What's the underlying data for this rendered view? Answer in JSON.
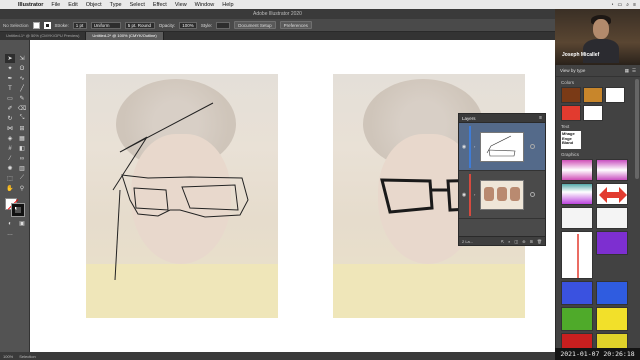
{
  "menubar": {
    "app_name": "Illustrator",
    "items": [
      "File",
      "Edit",
      "Object",
      "Type",
      "Select",
      "Effect",
      "View",
      "Window",
      "Help"
    ]
  },
  "window": {
    "title": "Adobe Illustrator 2020"
  },
  "controlbar": {
    "selection_label": "No Selection",
    "stroke_label": "Stroke:",
    "stroke_weight": "1 pt",
    "profile": "Uniform",
    "brush": "5 pt. Round",
    "opacity_label": "Opacity:",
    "opacity_value": "100%",
    "style_label": "Style:",
    "document_setup": "Document Setup",
    "preferences": "Preferences"
  },
  "tabs": [
    {
      "label": "Untitled-1* @ 50% (CMYK/GPU Preview)",
      "active": false
    },
    {
      "label": "Untitled-2* @ 100% (CMYK/Outline)",
      "active": true
    }
  ],
  "layers": {
    "title": "Layers",
    "footer_count": "2 La...",
    "rows": [
      {
        "name": "Layer 2",
        "selected": true
      },
      {
        "name": "Layer 1",
        "selected": false
      }
    ]
  },
  "libraries": {
    "user_name": "Joseph Micallef",
    "view_by": "View by type",
    "sections": {
      "colors": "Colors",
      "text": "Text",
      "graphics": "Graphics"
    },
    "colors": [
      "#7a3a16",
      "#c8862b",
      "#ffffff",
      "#e23b2f",
      "#ffffff"
    ],
    "text_sample": "Mhage Enge Bland"
  },
  "statusbar": {
    "zoom": "100%",
    "tool": "Selection"
  },
  "timestamp": "2021-01-07  20:26:18"
}
